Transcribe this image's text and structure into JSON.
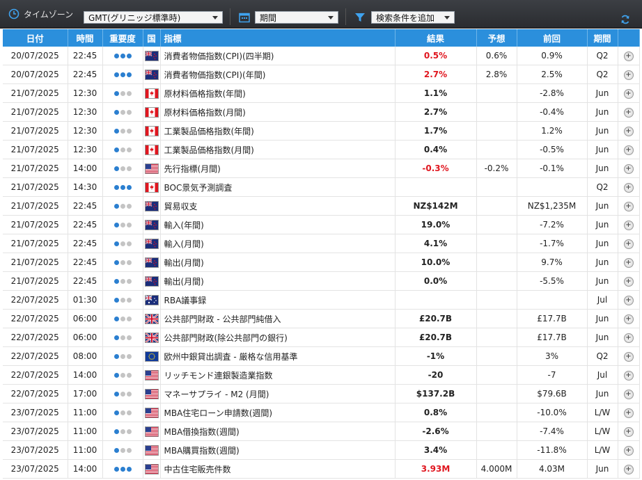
{
  "toolbar": {
    "timezone_label": "タイムゾーン",
    "timezone_value": "GMT(グリニッジ標準時)",
    "period_value": "期間",
    "filter_value": "検索条件を追加"
  },
  "columns": [
    "日付",
    "時間",
    "重要度",
    "国",
    "指標",
    "結果",
    "予想",
    "前回",
    "期間",
    ""
  ],
  "colors": {
    "header": "#2b8fdc",
    "importance_on": "#2b7fd0",
    "importance_off": "#c4c4c4",
    "negative_result": "#e0161f"
  },
  "rows": [
    {
      "date": "20/07/2025",
      "time": "22:45",
      "imp": 3,
      "country": "nz",
      "indicator": "消費者物価指数(CPI)(四半期)",
      "actual": "0.5%",
      "actual_red": true,
      "forecast": "0.6%",
      "previous": "0.9%",
      "period": "Q2"
    },
    {
      "date": "20/07/2025",
      "time": "22:45",
      "imp": 3,
      "country": "nz",
      "indicator": "消費者物価指数(CPI)(年間)",
      "actual": "2.7%",
      "actual_red": true,
      "forecast": "2.8%",
      "previous": "2.5%",
      "period": "Q2"
    },
    {
      "date": "21/07/2025",
      "time": "12:30",
      "imp": 1,
      "country": "ca",
      "indicator": "原材料価格指数(年間)",
      "actual": "1.1%",
      "actual_red": false,
      "forecast": "",
      "previous": "-2.8%",
      "period": "Jun"
    },
    {
      "date": "21/07/2025",
      "time": "12:30",
      "imp": 1,
      "country": "ca",
      "indicator": "原材料価格指数(月間)",
      "actual": "2.7%",
      "actual_red": false,
      "forecast": "",
      "previous": "-0.4%",
      "period": "Jun"
    },
    {
      "date": "21/07/2025",
      "time": "12:30",
      "imp": 1,
      "country": "ca",
      "indicator": "工業製品価格指数(年間)",
      "actual": "1.7%",
      "actual_red": false,
      "forecast": "",
      "previous": "1.2%",
      "period": "Jun"
    },
    {
      "date": "21/07/2025",
      "time": "12:30",
      "imp": 1,
      "country": "ca",
      "indicator": "工業製品価格指数(月間)",
      "actual": "0.4%",
      "actual_red": false,
      "forecast": "",
      "previous": "-0.5%",
      "period": "Jun"
    },
    {
      "date": "21/07/2025",
      "time": "14:00",
      "imp": 1,
      "country": "us",
      "indicator": "先行指標(月間)",
      "actual": "-0.3%",
      "actual_red": true,
      "forecast": "-0.2%",
      "previous": "-0.1%",
      "period": "Jun"
    },
    {
      "date": "21/07/2025",
      "time": "14:30",
      "imp": 3,
      "country": "ca",
      "indicator": "BOC景気予測調査",
      "actual": "",
      "actual_red": false,
      "forecast": "",
      "previous": "",
      "period": "Q2"
    },
    {
      "date": "21/07/2025",
      "time": "22:45",
      "imp": 1,
      "country": "nz",
      "indicator": "貿易収支",
      "actual": "NZ$142M",
      "actual_red": false,
      "forecast": "",
      "previous": "NZ$1,235M",
      "period": "Jun"
    },
    {
      "date": "21/07/2025",
      "time": "22:45",
      "imp": 1,
      "country": "nz",
      "indicator": "輸入(年間)",
      "actual": "19.0%",
      "actual_red": false,
      "forecast": "",
      "previous": "-7.2%",
      "period": "Jun"
    },
    {
      "date": "21/07/2025",
      "time": "22:45",
      "imp": 1,
      "country": "nz",
      "indicator": "輸入(月間)",
      "actual": "4.1%",
      "actual_red": false,
      "forecast": "",
      "previous": "-1.7%",
      "period": "Jun"
    },
    {
      "date": "21/07/2025",
      "time": "22:45",
      "imp": 1,
      "country": "nz",
      "indicator": "輸出(月間)",
      "actual": "10.0%",
      "actual_red": false,
      "forecast": "",
      "previous": "9.7%",
      "period": "Jun"
    },
    {
      "date": "21/07/2025",
      "time": "22:45",
      "imp": 1,
      "country": "nz",
      "indicator": "輸出(月間)",
      "actual": "0.0%",
      "actual_red": false,
      "forecast": "",
      "previous": "-5.5%",
      "period": "Jun"
    },
    {
      "date": "22/07/2025",
      "time": "01:30",
      "imp": 1,
      "country": "au",
      "indicator": "RBA議事録",
      "actual": "",
      "actual_red": false,
      "forecast": "",
      "previous": "",
      "period": "Jul"
    },
    {
      "date": "22/07/2025",
      "time": "06:00",
      "imp": 1,
      "country": "gb",
      "indicator": "公共部門財政 - 公共部門純借入",
      "actual": "£20.7B",
      "actual_red": false,
      "forecast": "",
      "previous": "£17.7B",
      "period": "Jun"
    },
    {
      "date": "22/07/2025",
      "time": "06:00",
      "imp": 1,
      "country": "gb",
      "indicator": "公共部門財政(除公共部門の銀行)",
      "actual": "£20.7B",
      "actual_red": false,
      "forecast": "",
      "previous": "£17.7B",
      "period": "Jun"
    },
    {
      "date": "22/07/2025",
      "time": "08:00",
      "imp": 1,
      "country": "eu",
      "indicator": "欧州中銀貸出調査 - 厳格な信用基準",
      "actual": "-1%",
      "actual_red": false,
      "forecast": "",
      "previous": "3%",
      "period": "Q2"
    },
    {
      "date": "22/07/2025",
      "time": "14:00",
      "imp": 1,
      "country": "us",
      "indicator": "リッチモンド連銀製造業指数",
      "actual": "-20",
      "actual_red": false,
      "forecast": "",
      "previous": "-7",
      "period": "Jul"
    },
    {
      "date": "22/07/2025",
      "time": "17:00",
      "imp": 1,
      "country": "us",
      "indicator": "マネーサプライ - M2 (月間)",
      "actual": "$137.2B",
      "actual_red": false,
      "forecast": "",
      "previous": "$79.6B",
      "period": "Jun"
    },
    {
      "date": "23/07/2025",
      "time": "11:00",
      "imp": 1,
      "country": "us",
      "indicator": "MBA住宅ローン申請数(週間)",
      "actual": "0.8%",
      "actual_red": false,
      "forecast": "",
      "previous": "-10.0%",
      "period": "L/W"
    },
    {
      "date": "23/07/2025",
      "time": "11:00",
      "imp": 1,
      "country": "us",
      "indicator": "MBA借換指数(週間)",
      "actual": "-2.6%",
      "actual_red": false,
      "forecast": "",
      "previous": "-7.4%",
      "period": "L/W"
    },
    {
      "date": "23/07/2025",
      "time": "11:00",
      "imp": 1,
      "country": "us",
      "indicator": "MBA購買指数(週間)",
      "actual": "3.4%",
      "actual_red": false,
      "forecast": "",
      "previous": "-11.8%",
      "period": "L/W"
    },
    {
      "date": "23/07/2025",
      "time": "14:00",
      "imp": 3,
      "country": "us",
      "indicator": "中古住宅販売件数",
      "actual": "3.93M",
      "actual_red": true,
      "forecast": "4.000M",
      "previous": "4.03M",
      "period": "Jun"
    }
  ]
}
